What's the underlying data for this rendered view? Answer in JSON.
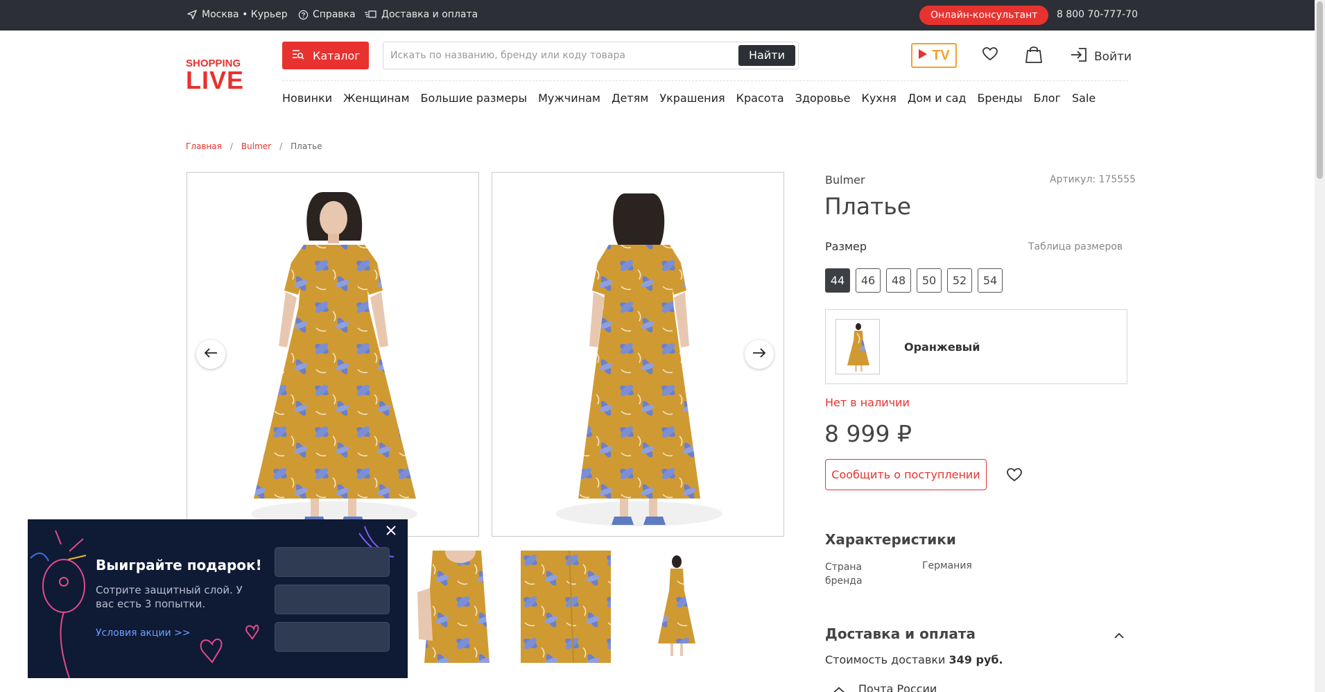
{
  "topbar": {
    "location": "Москва • Курьер",
    "help": "Справка",
    "delivery": "Доставка и оплата",
    "consultant": "Онлайн-консультант",
    "phone": "8 800 70-777-70"
  },
  "header": {
    "logo_line1": "SHOPPING",
    "logo_line2": "LIVE",
    "catalog_label": "Каталог",
    "search_placeholder": "Искать по названию, бренду или коду товара",
    "search_button": "Найти",
    "tv_label": "TV",
    "login_label": "Войти"
  },
  "nav": {
    "items": [
      "Новинки",
      "Женщинам",
      "Большие размеры",
      "Мужчинам",
      "Детям",
      "Украшения",
      "Красота",
      "Здоровье",
      "Кухня",
      "Дом и сад",
      "Бренды",
      "Блог",
      "Sale"
    ]
  },
  "breadcrumb": {
    "home": "Главная",
    "brand": "Bulmer",
    "current": "Платье",
    "separator": "/"
  },
  "product": {
    "brand": "Bulmer",
    "article": "Артикул: 175555",
    "title": "Платье",
    "size_label": "Размер",
    "size_table_label": "Таблица размеров",
    "sizes": [
      "44",
      "46",
      "48",
      "50",
      "52",
      "54"
    ],
    "selected_size": "44",
    "color_name": "Оранжевый",
    "stock_status": "Нет в наличии",
    "price": "8 999 ₽",
    "notify_button": "Сообщить о поступлении"
  },
  "characteristics": {
    "title": "Характеристики",
    "rows": [
      {
        "key": "Страна бренда",
        "value": "Германия"
      }
    ]
  },
  "delivery": {
    "title": "Доставка и оплата",
    "cost_prefix": "Стоимость доставки ",
    "cost_value": "349 руб.",
    "method": "Почта России"
  },
  "promo": {
    "title": "Выиграйте подарок!",
    "description": "Сотрите защитный слой. У вас есть 3 попытки.",
    "link": "Условия акции >>"
  },
  "colors": {
    "accent": "#e8322f",
    "topbar": "#2c2f35",
    "dress_ochre": "#d09a32",
    "dress_blue": "#6c80c9",
    "promo_bg": "#0f1a35"
  }
}
